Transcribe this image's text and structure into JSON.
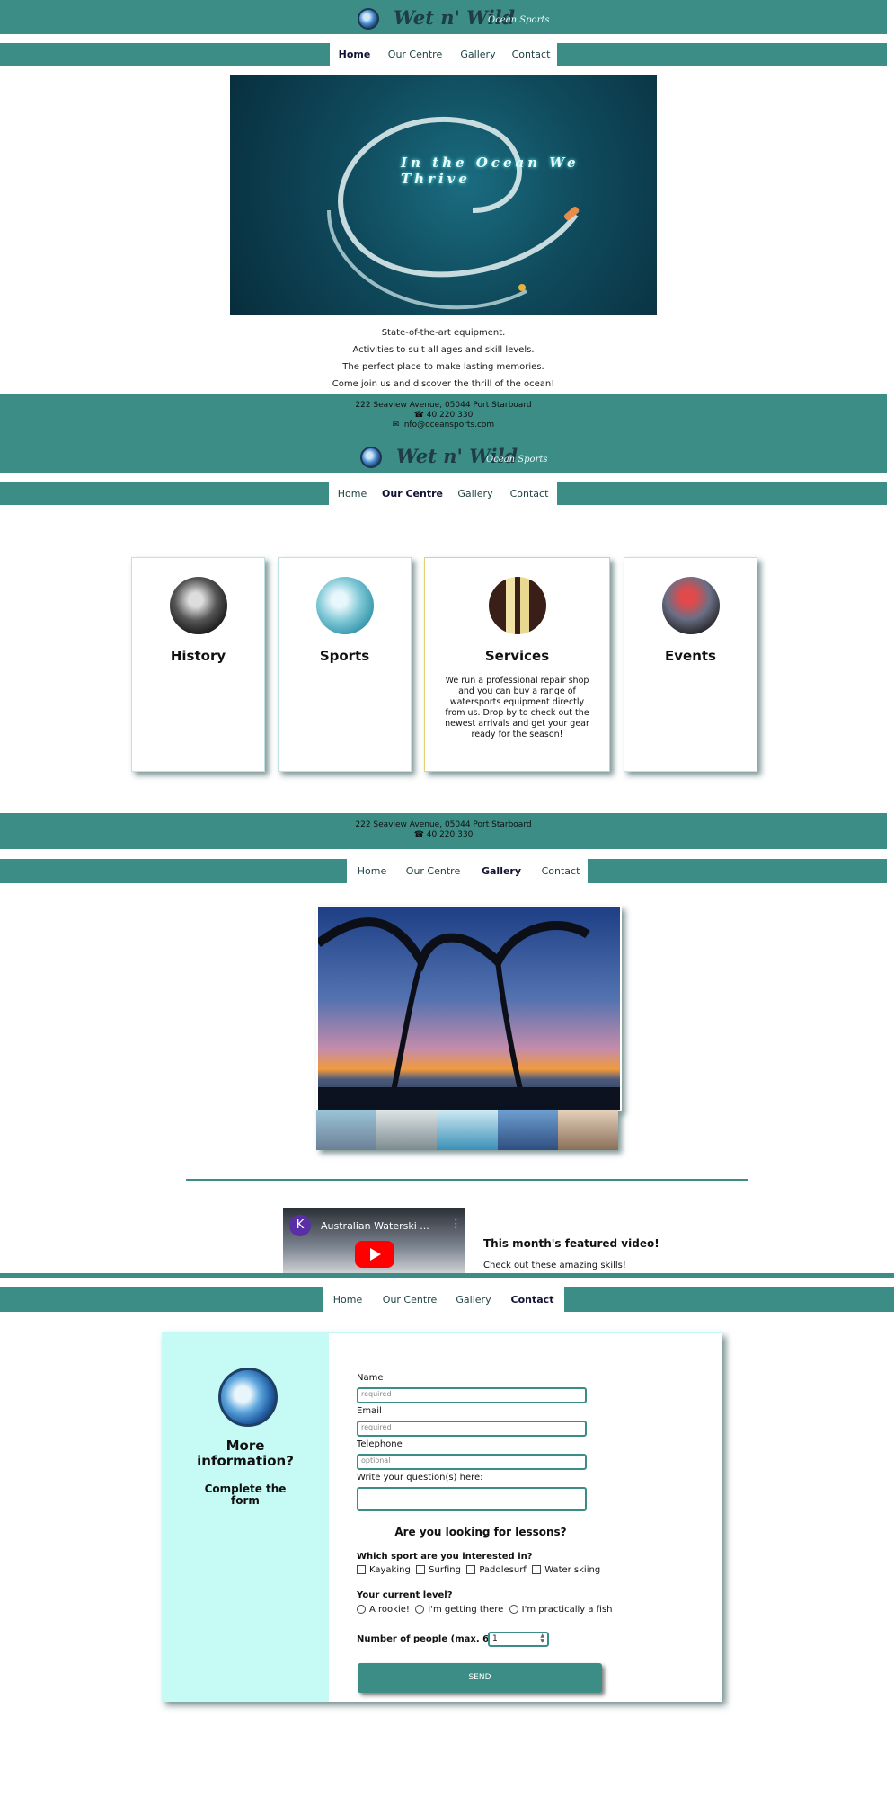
{
  "brand": {
    "name": "Wet n' Wild",
    "tagline": "Ocean Sports"
  },
  "nav": {
    "home": "Home",
    "centre": "Our Centre",
    "gallery": "Gallery",
    "contact": "Contact"
  },
  "hero": {
    "caption": "In the Ocean We Thrive"
  },
  "intro": {
    "lines": [
      "State-of-the-art equipment.",
      "Activities to suit all ages and skill levels.",
      "The perfect place to make lasting memories.",
      "Come join us and discover the thrill of the ocean!"
    ]
  },
  "footer": {
    "address": "222 Seaview Avenue, 05044 Port Starboard",
    "phone": "40 220 330",
    "email": "info@oceansports.com"
  },
  "cards": [
    {
      "title": "History",
      "text": ""
    },
    {
      "title": "Sports",
      "text": ""
    },
    {
      "title": "Services",
      "text": "We run a professional repair shop and you can buy a range of watersports equipment directly from us. Drop by to check out the newest arrivals and get your gear ready for the season!"
    },
    {
      "title": "Events",
      "text": ""
    }
  ],
  "video": {
    "channel_initial": "K",
    "title": "Australian Waterski ...",
    "heading": "This month's featured video!",
    "text": "Check out these amazing skills!"
  },
  "contact": {
    "side_title": "More information?",
    "side_sub": "Complete the form",
    "name_label": "Name",
    "name_placeholder": "required",
    "email_label": "Email",
    "email_placeholder": "required",
    "phone_label": "Telephone",
    "phone_placeholder": "optional",
    "question_label": "Write your question(s) here:",
    "lessons_heading": "Are you looking for lessons?",
    "sport_label": "Which sport are you interested in?",
    "sports": [
      "Kayaking",
      "Surfing",
      "Paddlesurf",
      "Water skiing"
    ],
    "level_label": "Your current level?",
    "levels": [
      "A rookie!",
      "I'm getting there",
      "I'm practically a fish"
    ],
    "people_label": "Number of people (max. 6)",
    "people_value": "1",
    "send": "SEND"
  },
  "colors": {
    "teal": "#3b8d86",
    "mint": "#c5fbf4",
    "services_border": "#e4cf72"
  }
}
